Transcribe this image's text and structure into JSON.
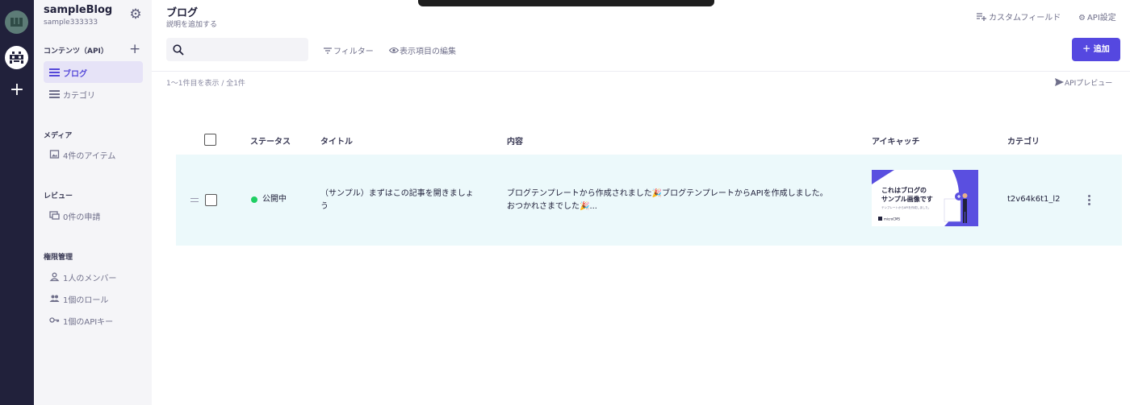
{
  "service": {
    "name": "sampleBlog",
    "id": "sample333333"
  },
  "sidebar": {
    "content_section": "コンテンツ（API）",
    "content_items": [
      {
        "label": "ブログ"
      },
      {
        "label": "カテゴリ"
      }
    ],
    "media_section": "メディア",
    "media_label": "4件のアイテム",
    "review_section": "レビュー",
    "review_label": "0件の申請",
    "perm_section": "権限管理",
    "perm_items": [
      {
        "label": "1人のメンバー"
      },
      {
        "label": "1個のロール"
      },
      {
        "label": "1個のAPIキー"
      }
    ],
    "add_symbol": "+"
  },
  "header": {
    "title": "ブログ",
    "description": "説明を追加する",
    "custom_field": "カスタムフィールド",
    "api_settings": "API設定"
  },
  "toolbar": {
    "search_placeholder": "",
    "filter": "フィルター",
    "edit_columns": "表示項目の編集",
    "add_button": "＋ 追加"
  },
  "list": {
    "count_text": "1〜1件目を表示 / 全1件",
    "api_preview": "APIプレビュー",
    "columns": [
      "ステータス",
      "タイトル",
      "内容",
      "アイキャッチ",
      "カテゴリ"
    ],
    "rows": [
      {
        "status": "公開中",
        "title_line1": "（サンプル）まずはこの記事を開きましょ",
        "title_line2": "う",
        "content_line1": "ブログテンプレートから作成されました🎉ブログテンプレートからAPIを作成しました。",
        "content_line2": "おつかれさまでした🎉...",
        "eyecatch_title1": "これはブログの",
        "eyecatch_title2": "サンプル画像です",
        "eyecatch_sub": "テンプレートからAPIを作成しました。",
        "eyecatch_brand": "microCMS",
        "category": "t2v64k6t1_l2"
      }
    ]
  },
  "colors": {
    "accent": "#5548e0",
    "status_public": "#1fcf63",
    "row_highlight": "#ecf9fb"
  }
}
